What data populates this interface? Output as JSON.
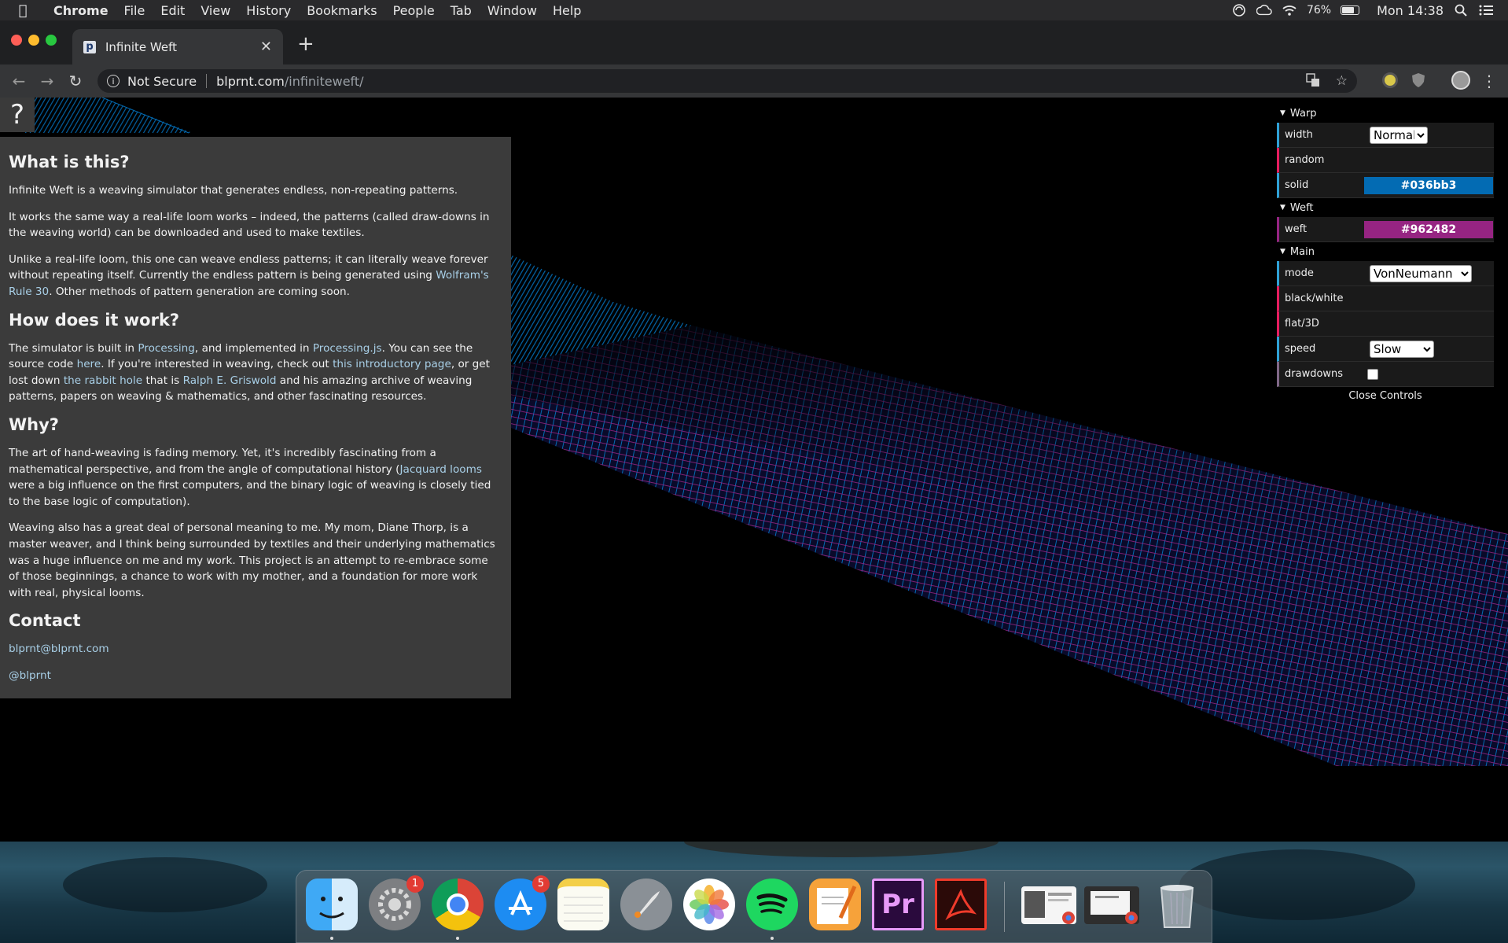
{
  "menubar": {
    "app": "Chrome",
    "menus": [
      "File",
      "Edit",
      "View",
      "History",
      "Bookmarks",
      "People",
      "Tab",
      "Window",
      "Help"
    ],
    "battery_percent": "76%",
    "battery_level": 0.76,
    "clock": "Mon 14:38"
  },
  "browser": {
    "tab_title": "Infinite Weft",
    "favicon_letter": "p",
    "security_label": "Not Secure",
    "url_host": "blprnt.com",
    "url_path": "/infiniteweft/"
  },
  "page": {
    "help_label": "?",
    "sections": {
      "what_title": "What is this?",
      "what_p1": "Infinite Weft is a weaving simulator that generates endless, non-repeating patterns.",
      "what_p2": "It works the same way a real-life loom works – indeed, the patterns (called draw-downs in the weaving world) can be downloaded and used to make textiles.",
      "what_p3_a": "Unlike a real-life loom, this one can weave endless patterns; it can literally weave forever without repeating itself. Currently the endless pattern is being generated using ",
      "what_p3_link": "Wolfram's Rule 30",
      "what_p3_b": ". Other methods of pattern generation are coming soon.",
      "how_title": "How does it work?",
      "how_a": "The simulator is built in ",
      "how_link1": "Processing",
      "how_b": ", and implemented in ",
      "how_link2": "Processing.js",
      "how_c": ". You can see the source code ",
      "how_link3": "here",
      "how_d": ". If you're interested in weaving, check out ",
      "how_link4": "this introductory page",
      "how_e": ", or get lost down ",
      "how_link5": "the rabbit hole",
      "how_f": " that is ",
      "how_link6": "Ralph E. Griswold",
      "how_g": " and his amazing archive of weaving patterns, papers on weaving & mathematics, and other fascinating resources.",
      "why_title": "Why?",
      "why_p1_a": "The art of hand-weaving is fading memory. Yet, it's incredibly fascinating from a mathematical perspective, and from the angle of computational history (",
      "why_p1_link": "Jacquard looms",
      "why_p1_b": " were a big influence on the first computers, and the binary logic of weaving is closely tied to the base logic of computation).",
      "why_p2": "Weaving also has a great deal of personal meaning to me. My mom, Diane Thorp, is a master weaver, and I think being surrounded by textiles and their underlying mathematics was a huge influence on me and my work. This project is an attempt to re-embrace some of those beginnings, a chance to work with my mother, and a foundation for more work with real, physical looms.",
      "contact_title": "Contact",
      "contact_email": "blprnt@blprnt.com",
      "contact_handle": "@blprnt"
    }
  },
  "gui": {
    "warp_folder": "Warp",
    "width_label": "width",
    "width_value": "Normal",
    "random_label": "random",
    "solid_label": "solid",
    "solid_value": "#036bb3",
    "weft_folder": "Weft",
    "weft_label": "weft",
    "weft_value": "#962482",
    "main_folder": "Main",
    "mode_label": "mode",
    "mode_value": "VonNeumann",
    "bw_label": "black/white",
    "flat_label": "flat/3D",
    "speed_label": "speed",
    "speed_value": "Slow",
    "drawdowns_label": "drawdowns",
    "close_label": "Close Controls"
  },
  "dock": {
    "system_prefs_badge": "1",
    "app_store_badge": "5",
    "icons": [
      "finder-icon",
      "system-preferences-icon",
      "chrome-icon",
      "app-store-icon",
      "notes-icon",
      "launchpad-icon",
      "photos-icon",
      "spotify-icon",
      "pages-icon",
      "premiere-icon",
      "acrobat-icon",
      "chrome-window-thumbnail",
      "chrome-window-thumbnail-2",
      "trash-icon"
    ]
  },
  "colors": {
    "warp": "#036bb3",
    "weft": "#962482",
    "link": "#a8cfe7"
  }
}
